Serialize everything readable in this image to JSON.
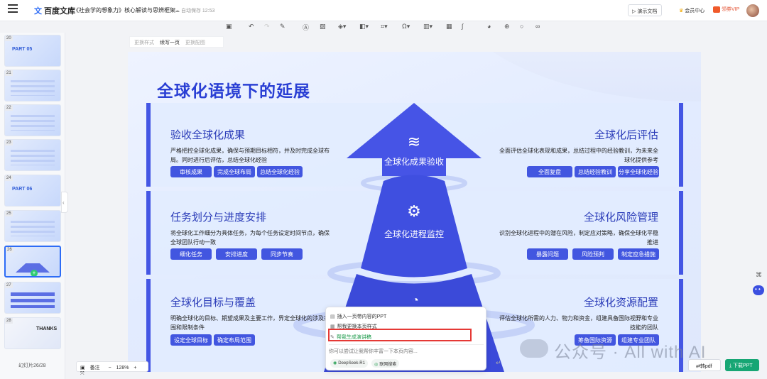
{
  "header": {
    "logo_mark": "文",
    "logo_text": "百度文库",
    "doc_title": "《社会学的想象力》核心解读与思辨框架",
    "autosave": "自动保存 12:53",
    "present": "演示文档",
    "vip": "会员中心",
    "gift": "领券VIP"
  },
  "subtoolbar": {
    "change_style": "更换样式",
    "continue_page": "续写一页",
    "change_image": "更换配图"
  },
  "toolbar_icons": [
    "save-icon",
    "undo-icon",
    "redo-icon",
    "format-brush-icon",
    "text-icon",
    "image-icon",
    "shape-icon",
    "chart-icon",
    "crop-icon",
    "symbol-icon",
    "bar-chart-icon",
    "table-icon",
    "formula-icon",
    "palette-icon",
    "add-icon",
    "search-icon",
    "link-icon"
  ],
  "thumbnails": [
    {
      "num": "20",
      "title": "PART 05"
    },
    {
      "num": "21",
      "title": ""
    },
    {
      "num": "22",
      "title": ""
    },
    {
      "num": "23",
      "title": ""
    },
    {
      "num": "24",
      "title": "PART 06"
    },
    {
      "num": "25",
      "title": ""
    },
    {
      "num": "26",
      "title": ""
    },
    {
      "num": "27",
      "title": ""
    },
    {
      "num": "28",
      "title": "THANKS"
    }
  ],
  "slide_count": "幻灯片26/28",
  "slide": {
    "title": "全球化语境下的延展",
    "blocks": {
      "tl": {
        "h": "验收全球化成果",
        "p": "严格把控全球化成果，确保与预期目标相符，并及时完成全球布局。同时进行后评估，总结全球化经验",
        "chips": [
          "审核成果",
          "完成全球布局",
          "总结全球化经验"
        ]
      },
      "tr": {
        "h": "全球化后评估",
        "p": "全面评估全球化表现和成果，总结过程中的经验教训，为未来全球化提供参考",
        "chips": [
          "全面复盘",
          "总结经验教训",
          "分享全球化经验"
        ]
      },
      "ml": {
        "h": "任务划分与进度安排",
        "p": "将全球化工作细分为具体任务，为每个任务设定时间节点，确保全球团队行动一致",
        "chips": [
          "细化任务",
          "安排进度",
          "同步节奏"
        ]
      },
      "mr": {
        "h": "全球化风险管理",
        "p": "识别全球化进程中的潜在风险，制定应对策略，确保全球化平稳推进",
        "chips": [
          "暴露问题",
          "风险预判",
          "制定应急措施"
        ]
      },
      "bl": {
        "h": "全球化目标与覆盖",
        "p": "明确全球化的目标、期望成果及主要工作，界定全球化的涉及范围和限制条件",
        "chips": [
          "设定全球目标",
          "确定布局范围"
        ]
      },
      "br": {
        "h": "全球化资源配置",
        "p": "评估全球化所需的人力、物力和资金，组建具备国际视野和专业技能的团队",
        "chips": [
          "筹备国际资源",
          "组建专业团队"
        ]
      }
    },
    "pyramid": {
      "top": "全球化成果验收",
      "mid": "全球化进程监控"
    }
  },
  "popup": {
    "opt1": "插入一页带内容的PPT",
    "opt2": "帮我更换本页样式",
    "opt3": "帮我生成演讲稿",
    "placeholder": "你可以尝试让我帮你丰富一下本页内容...",
    "model": "DeepSeek-R1",
    "web": "联网搜索"
  },
  "zoom": {
    "note": "备注",
    "level": "128%"
  },
  "footer": {
    "pdf": "转pdf",
    "download": "下载PPT"
  },
  "watermark": "公众号 · All with AI",
  "colors": {
    "accent": "#2d6cf6",
    "slide_blue": "#4256e0",
    "download_green": "#17a674",
    "highlight_red": "#e53935"
  }
}
